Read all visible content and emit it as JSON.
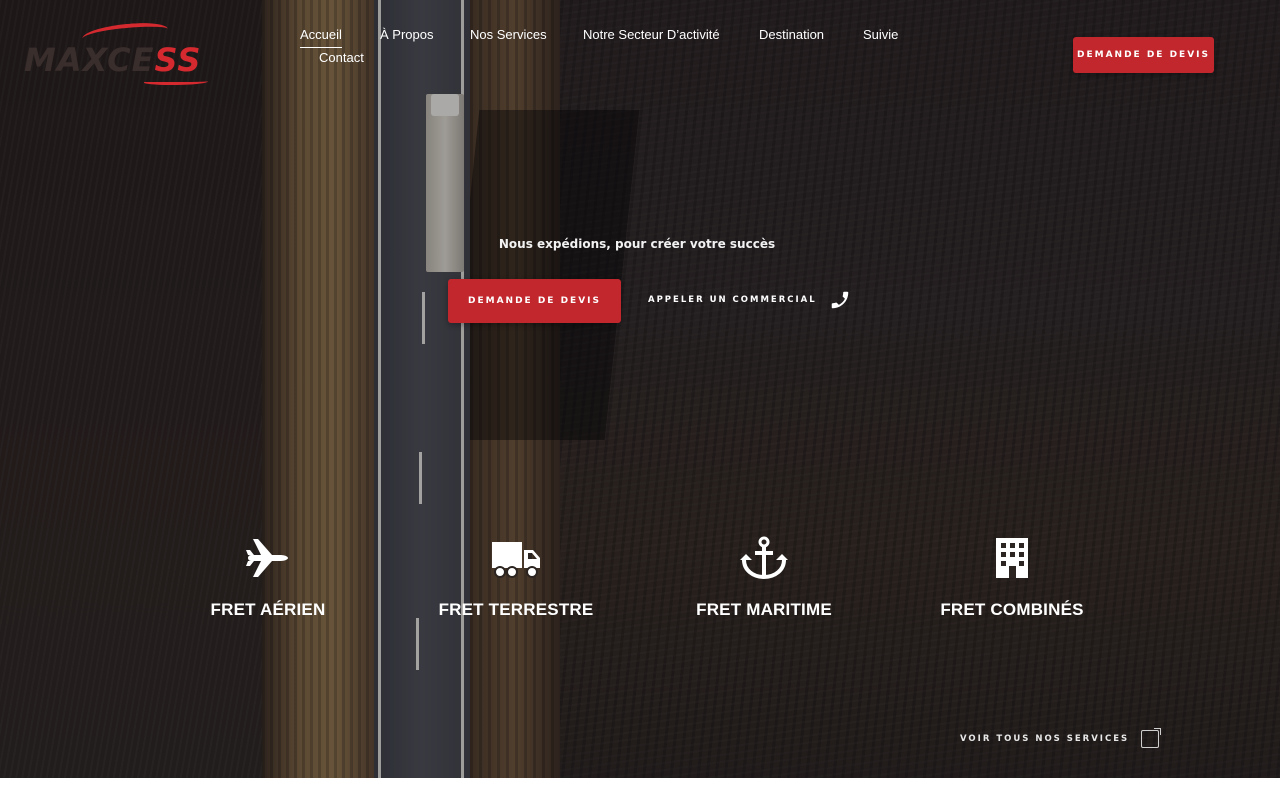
{
  "brand": {
    "logo_prefix": "MAXCE",
    "logo_suffix": "SS"
  },
  "nav": {
    "items": [
      {
        "label": "Accueil"
      },
      {
        "label": "À Propos"
      },
      {
        "label": "Nos Services"
      },
      {
        "label": "Notre Secteur D’activité"
      },
      {
        "label": "Destination"
      },
      {
        "label": "Suivie"
      },
      {
        "label": "Contact"
      }
    ]
  },
  "header": {
    "cta_label": "DEMANDE DE DEVIS"
  },
  "hero": {
    "tagline": "Nous expédions, pour créer votre succès",
    "cta_label": "DEMANDE DE DEVIS",
    "call_label": "APPELER UN COMMERCIAL"
  },
  "services": [
    {
      "label": "FRET AÉRIEN",
      "icon": "plane-icon"
    },
    {
      "label": "FRET TERRESTRE",
      "icon": "truck-icon"
    },
    {
      "label": "FRET MARITIME",
      "icon": "anchor-icon"
    },
    {
      "label": "FRET COMBINÉS",
      "icon": "building-icon"
    }
  ],
  "all_services_label": "VOIR TOUS NOS SERVICES",
  "colors": {
    "accent": "#c1272d"
  }
}
